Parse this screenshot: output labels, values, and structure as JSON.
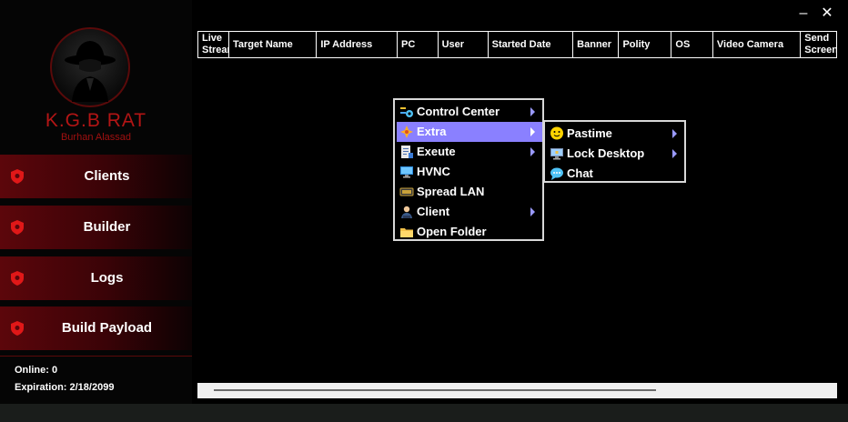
{
  "window": {
    "minimize_glyph": "–",
    "close_glyph": "✕"
  },
  "brand": {
    "title": "K.G.B RAT",
    "subtitle": "Burhan Alassad",
    "logo_icon": "spy-hat-icon"
  },
  "sidebar": {
    "items": [
      {
        "label": "Clients",
        "icon": "shield-icon"
      },
      {
        "label": "Builder",
        "icon": "shield-icon"
      },
      {
        "label": "Logs",
        "icon": "shield-icon"
      },
      {
        "label": "Build Payload",
        "icon": "shield-icon"
      }
    ],
    "online": "Online: 0",
    "expiration": "Expiration: 2/18/2099"
  },
  "grid": {
    "columns": [
      "Live Stream",
      "Target Name",
      "IP Address",
      "PC",
      "User",
      "Started Date",
      "Banner",
      "Polity",
      "OS",
      "Video Camera",
      "Send Screen"
    ]
  },
  "context_menu": {
    "items": [
      {
        "label": "Control Center",
        "icon": "tools-icon",
        "submenu": true
      },
      {
        "label": "Extra",
        "icon": "sparkle-icon",
        "submenu": true,
        "active": true
      },
      {
        "label": "Exeute",
        "icon": "document-icon",
        "submenu": true
      },
      {
        "label": "HVNC",
        "icon": "monitor-icon",
        "submenu": false
      },
      {
        "label": "Spread LAN",
        "icon": "vip-icon",
        "submenu": false
      },
      {
        "label": "Client",
        "icon": "person-icon",
        "submenu": true
      },
      {
        "label": "Open Folder",
        "icon": "folder-icon",
        "submenu": false
      }
    ]
  },
  "submenu": {
    "items": [
      {
        "label": "Pastime",
        "icon": "smiley-icon",
        "submenu": true
      },
      {
        "label": "Lock Desktop",
        "icon": "desktop-icon",
        "submenu": true
      },
      {
        "label": "Chat",
        "icon": "chat-bubble-icon",
        "submenu": false
      }
    ]
  },
  "colors": {
    "accent": "#8a80ff",
    "brand_red": "#b31515",
    "nav_red": "#5c060b"
  }
}
